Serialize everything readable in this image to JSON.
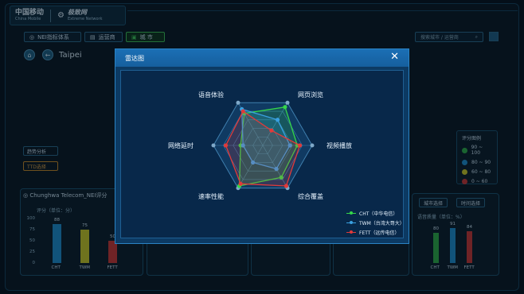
{
  "header": {
    "brand_cn": "中国移动",
    "brand_en": "China Mobile",
    "brand2_cn": "极致网",
    "brand2_en": "Extreme Network"
  },
  "nav": {
    "tabs": [
      {
        "label": "NEI指标体系"
      },
      {
        "label": "运营商"
      },
      {
        "label": "城 市"
      }
    ],
    "search_placeholder": "搜索城市 / 运营商"
  },
  "location": {
    "city": "Taipei"
  },
  "side_buttons": [
    {
      "label": "趋势分析"
    },
    {
      "label": "TTD选择"
    }
  ],
  "bottom_panel": {
    "title": "Chunghwa Telecom_NEI评分",
    "score_axis_label": "评分（单位：分）",
    "axis_ticks": [
      "100",
      "75",
      "50",
      "25",
      "0"
    ],
    "bars": [
      {
        "name": "CHT",
        "value": 88,
        "color": "#1e8fd0"
      },
      {
        "name": "TWM",
        "value": 75,
        "color": "#c9c928"
      },
      {
        "name": "FETT",
        "value": 50,
        "color": "#c93838"
      }
    ]
  },
  "right_panel": {
    "buttons": [
      "城市选择",
      "时间选择"
    ],
    "quality_label": "语音质量（单位：%）",
    "bars": [
      {
        "name": "CHT",
        "value": 80,
        "color": "#2fae4a"
      },
      {
        "name": "TWM",
        "value": 91,
        "color": "#1e8fd0"
      },
      {
        "name": "FETT",
        "value": 84,
        "color": "#c93838"
      }
    ]
  },
  "score_legend": {
    "title": "评分图例",
    "items": [
      {
        "label": "90 ~ 100",
        "color": "#2fae4a"
      },
      {
        "label": "80 ~ 90",
        "color": "#1e8fd0"
      },
      {
        "label": "60 ~ 80",
        "color": "#c9c928"
      },
      {
        "label": "0 ~ 60",
        "color": "#c93838"
      }
    ]
  },
  "modal": {
    "title": "雷达图",
    "close_label": "✕"
  },
  "chart_data": {
    "type": "radar",
    "title": "雷达图",
    "axes": [
      "网页浏览",
      "视频播放",
      "综合覆盖",
      "速率性能",
      "网络延时",
      "语音体验"
    ],
    "range": [
      0,
      100
    ],
    "series": [
      {
        "name": "CHT（中华电信）",
        "color": "#35d64a",
        "values": [
          90,
          70,
          75,
          95,
          45,
          75
        ]
      },
      {
        "name": "TWM（台湾大哥大）",
        "color": "#3aa0e0",
        "values": [
          60,
          55,
          55,
          40,
          40,
          85
        ]
      },
      {
        "name": "FETT（远传电信）",
        "color": "#e03a3a",
        "values": [
          35,
          75,
          95,
          90,
          75,
          80
        ]
      }
    ]
  }
}
